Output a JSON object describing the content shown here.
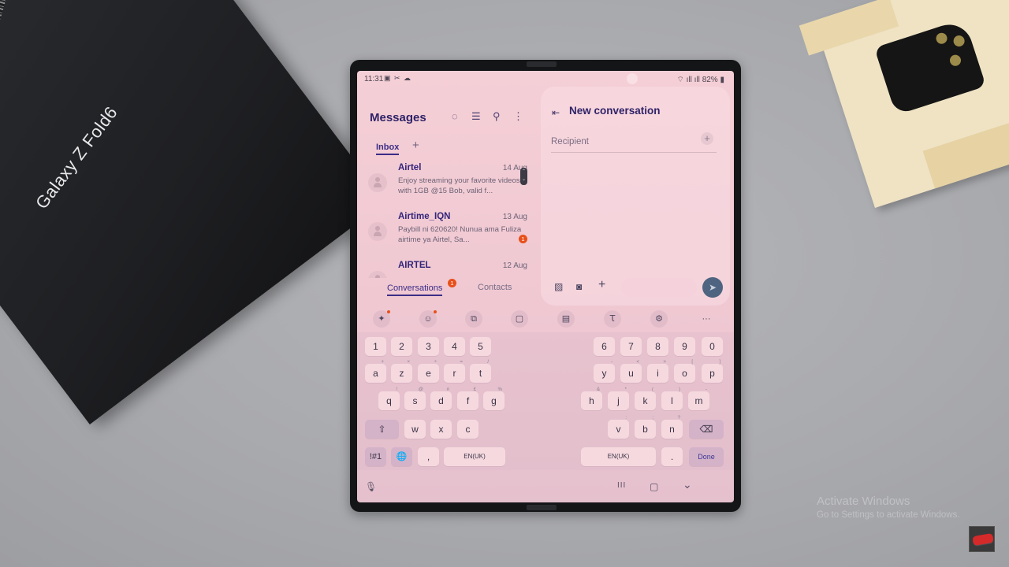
{
  "background": {
    "box_text": "Galaxy Z Fold6",
    "warranty_text": "WARRANTY",
    "watermark": {
      "line1": "Activate Windows",
      "line2": "Go to Settings to activate Windows."
    }
  },
  "status_bar": {
    "time": "11:31",
    "left_icons": "▣ ✂ ☁",
    "right_icons": "⌔ ıll ıll",
    "battery": "82%"
  },
  "messages_app": {
    "title": "Messages",
    "toolbar_icons": [
      "new-chat-icon",
      "filter-icon",
      "search-icon",
      "more-options-icon"
    ],
    "tabs": [
      {
        "label": "Inbox",
        "active": true
      }
    ],
    "add_tab": "+",
    "conversations": [
      {
        "name": "Airtel",
        "date": "14 Aug",
        "preview": "Enjoy streaming your favorite videos with 1GB @15 Bob, valid f...",
        "unread": null
      },
      {
        "name": "Airtime_IQN",
        "date": "13 Aug",
        "preview": "Paybill ni 620620! Nunua ama Fuliza airtime ya Airtel, Sa...",
        "unread": "1"
      },
      {
        "name": "AIRTEL",
        "date": "12 Aug",
        "preview": "",
        "unread": null
      }
    ],
    "bottom_tabs": {
      "conversations": "Conversations",
      "conversations_badge": "1",
      "contacts": "Contacts"
    }
  },
  "new_conversation": {
    "back_icon": "⇤",
    "title": "New conversation",
    "recipient_placeholder": "Recipient",
    "recipient_add": "+",
    "compose_icons": [
      "gallery-icon",
      "camera-icon",
      "plus-icon"
    ],
    "send_icon": "➤"
  },
  "keyboard": {
    "toolbar": [
      {
        "name": "ai-tools",
        "glyph": "✦",
        "dot": true
      },
      {
        "name": "emoji",
        "glyph": "☺",
        "dot": true
      },
      {
        "name": "translate",
        "glyph": "⧉",
        "dot": false
      },
      {
        "name": "clipboard",
        "glyph": "▢",
        "dot": false
      },
      {
        "name": "screen-mode",
        "glyph": "▤",
        "dot": false
      },
      {
        "name": "handwriting",
        "glyph": "Ꚍ",
        "dot": false
      },
      {
        "name": "settings",
        "glyph": "⚙",
        "dot": false
      },
      {
        "name": "more",
        "glyph": "···",
        "dot": false
      }
    ],
    "left": {
      "row1": [
        "1",
        "2",
        "3",
        "4",
        "5"
      ],
      "row2": [
        [
          "a",
          "+"
        ],
        [
          "z",
          "×"
        ],
        [
          "e",
          "÷"
        ],
        [
          "r",
          "="
        ],
        [
          "t",
          "/"
        ]
      ],
      "row3": [
        [
          "q",
          "!"
        ],
        [
          "s",
          "@"
        ],
        [
          "d",
          "#"
        ],
        [
          "f",
          "£"
        ],
        [
          "g",
          "%"
        ]
      ],
      "row4": [
        [
          "w",
          ""
        ],
        [
          "x",
          ""
        ],
        [
          "c",
          ""
        ]
      ],
      "shift": "⇧",
      "symbols": "!#1",
      "language": "🌐",
      "comma": ",",
      "space": "EN(UK)"
    },
    "right": {
      "row1": [
        "6",
        "7",
        "8",
        "9",
        "0"
      ],
      "row2": [
        [
          "y",
          "-"
        ],
        [
          "u",
          "<"
        ],
        [
          "i",
          ">"
        ],
        [
          "o",
          "["
        ],
        [
          "p",
          "]"
        ]
      ],
      "row3": [
        [
          "h",
          "&"
        ],
        [
          "j",
          "*"
        ],
        [
          "k",
          "("
        ],
        [
          "l",
          ")"
        ],
        [
          "m",
          "-"
        ]
      ],
      "row4": [
        [
          "v",
          ":"
        ],
        [
          "b",
          ";"
        ],
        [
          "n",
          "?"
        ]
      ],
      "backspace": "⌫",
      "space": "EN(UK)",
      "period": ".",
      "done": "Done"
    },
    "mic_icon": "🎙"
  },
  "nav_bar": {
    "recents": "III",
    "home": "▢",
    "hide_keyboard": "⌄"
  }
}
